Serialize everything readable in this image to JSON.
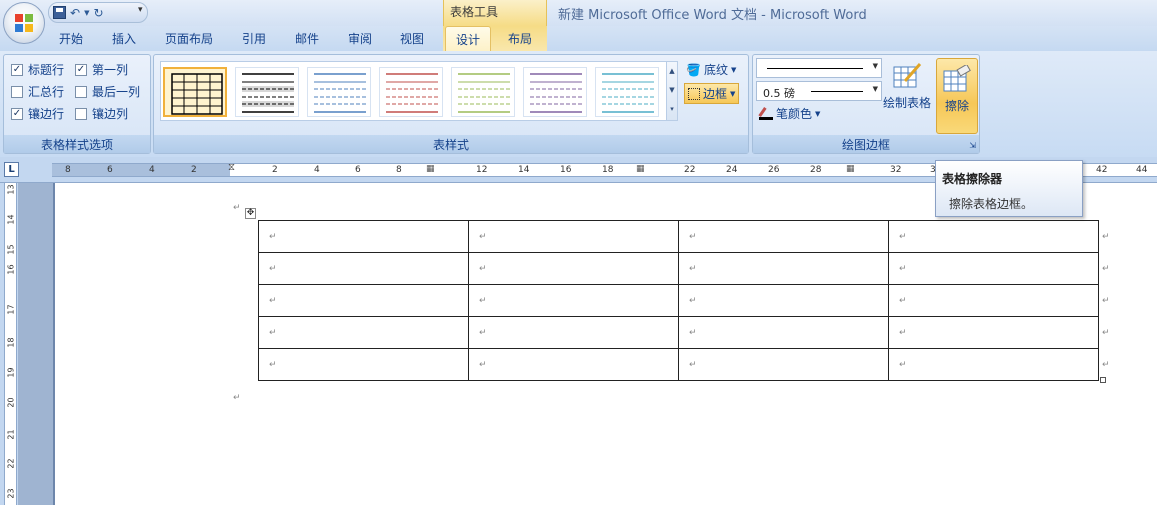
{
  "titlebar": {
    "context_tools": "表格工具",
    "doc_title": "新建 Microsoft Office Word 文档 - Microsoft Word"
  },
  "tabs": [
    "开始",
    "插入",
    "页面布局",
    "引用",
    "邮件",
    "审阅",
    "视图",
    "设计",
    "布局"
  ],
  "active_tab": "设计",
  "style_options": {
    "label": "表格样式选项",
    "items": [
      {
        "label": "标题行",
        "checked": true
      },
      {
        "label": "第一列",
        "checked": true
      },
      {
        "label": "汇总行",
        "checked": false
      },
      {
        "label": "最后一列",
        "checked": false
      },
      {
        "label": "镶边行",
        "checked": true
      },
      {
        "label": "镶边列",
        "checked": false
      }
    ]
  },
  "table_styles": {
    "label": "表样式",
    "shading": "底纹",
    "borders": "边框",
    "swatch_colors": [
      "#000000",
      "#000000",
      "#4f81bd",
      "#c0504d",
      "#9bbb59",
      "#8064a2",
      "#4bacc6"
    ]
  },
  "draw_borders": {
    "label": "绘图边框",
    "line_weight": "0.5 磅",
    "pen_color": "笔颜色",
    "draw_table": "绘制表格",
    "eraser": "擦除"
  },
  "tooltip": {
    "title": "表格擦除器",
    "text": "擦除表格边框。"
  },
  "ruler": {
    "h_numbers": [
      "8",
      "6",
      "4",
      "2",
      "2",
      "4",
      "6",
      "8",
      "12",
      "14",
      "16",
      "18",
      "22",
      "24",
      "26",
      "28",
      "32",
      "3",
      "42",
      "44"
    ],
    "v_numbers": [
      "13",
      "14",
      "15",
      "16",
      "17",
      "18",
      "19",
      "20",
      "21",
      "22",
      "23"
    ]
  },
  "document": {
    "rows": 5,
    "cols": 4,
    "para_mark": "↵"
  }
}
